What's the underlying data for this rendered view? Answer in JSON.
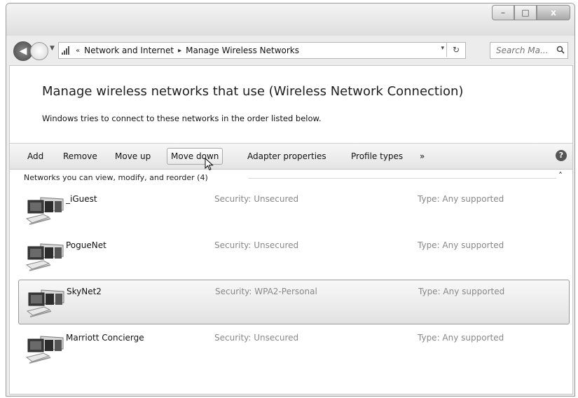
{
  "window": {
    "minimize_glyph": "–",
    "maximize_glyph": "□",
    "close_glyph": "x"
  },
  "address": {
    "prefix_glyph": "«",
    "crumbs": [
      "Network and Internet",
      "Manage Wireless Networks"
    ],
    "separator_glyph": "▸",
    "dropdown_glyph": "▾",
    "refresh_glyph": "↻"
  },
  "search": {
    "placeholder": "Search Ma...",
    "icon": "search-icon"
  },
  "main": {
    "heading": "Manage wireless networks that use (Wireless Network Connection)",
    "subtext": "Windows tries to connect to these networks in the order listed below."
  },
  "toolbar": {
    "add": "Add",
    "remove": "Remove",
    "move_up": "Move up",
    "move_down": "Move down",
    "adapter_properties": "Adapter properties",
    "profile_types": "Profile types",
    "overflow": "»",
    "help": "?"
  },
  "group": {
    "label": "Networks you can view, modify, and reorder (4)",
    "collapse_glyph": "˄"
  },
  "networks": [
    {
      "name": "_iGuest",
      "security": "Security: Unsecured",
      "type": "Type: Any supported",
      "icon": "wireless-network-icon"
    },
    {
      "name": "PogueNet",
      "security": "Security: Unsecured",
      "type": "Type: Any supported",
      "icon": "wireless-network-icon"
    },
    {
      "name": "SkyNet2",
      "security": "Security: WPA2-Personal",
      "type": "Type: Any supported",
      "icon": "wireless-network-icon",
      "selected": true
    },
    {
      "name": "Marriott Concierge",
      "security": "Security: Unsecured",
      "type": "Type: Any supported",
      "icon": "wireless-network-icon"
    }
  ]
}
